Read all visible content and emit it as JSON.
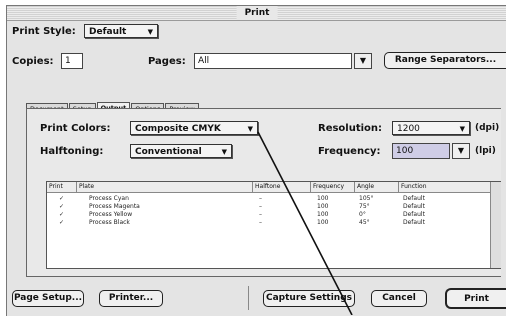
{
  "window": {
    "title": "Print"
  },
  "print_style": {
    "label": "Print Style:",
    "value": "Default"
  },
  "copies": {
    "label": "Copies:",
    "value": "1"
  },
  "pages": {
    "label": "Pages:",
    "value": "All"
  },
  "range_separators_button": "Range Separators...",
  "tabs": [
    "Document",
    "Setup",
    "Output",
    "Options",
    "Preview"
  ],
  "active_tab": "Output",
  "print_colors": {
    "label": "Print Colors:",
    "value": "Composite CMYK"
  },
  "halftoning": {
    "label": "Halftoning:",
    "value": "Conventional"
  },
  "resolution": {
    "label": "Resolution:",
    "value": "1200",
    "unit": "(dpi)"
  },
  "frequency": {
    "label": "Frequency:",
    "value": "100",
    "unit": "(lpi)"
  },
  "plates_table": {
    "columns": [
      "Print",
      "Plate",
      "Halftone",
      "Frequency",
      "Angle",
      "Function"
    ],
    "rows": [
      {
        "print": "✓",
        "plate": "Process Cyan",
        "halftone": "–",
        "frequency": "100",
        "angle": "105°",
        "function": "Default"
      },
      {
        "print": "✓",
        "plate": "Process Magenta",
        "halftone": "–",
        "frequency": "100",
        "angle": "75°",
        "function": "Default"
      },
      {
        "print": "✓",
        "plate": "Process Yellow",
        "halftone": "–",
        "frequency": "100",
        "angle": "0°",
        "function": "Default"
      },
      {
        "print": "✓",
        "plate": "Process Black",
        "halftone": "–",
        "frequency": "100",
        "angle": "45°",
        "function": "Default"
      }
    ]
  },
  "buttons": {
    "page_setup": "Page Setup...",
    "printer": "Printer...",
    "capture_settings": "Capture Settings",
    "cancel": "Cancel",
    "print": "Print"
  }
}
